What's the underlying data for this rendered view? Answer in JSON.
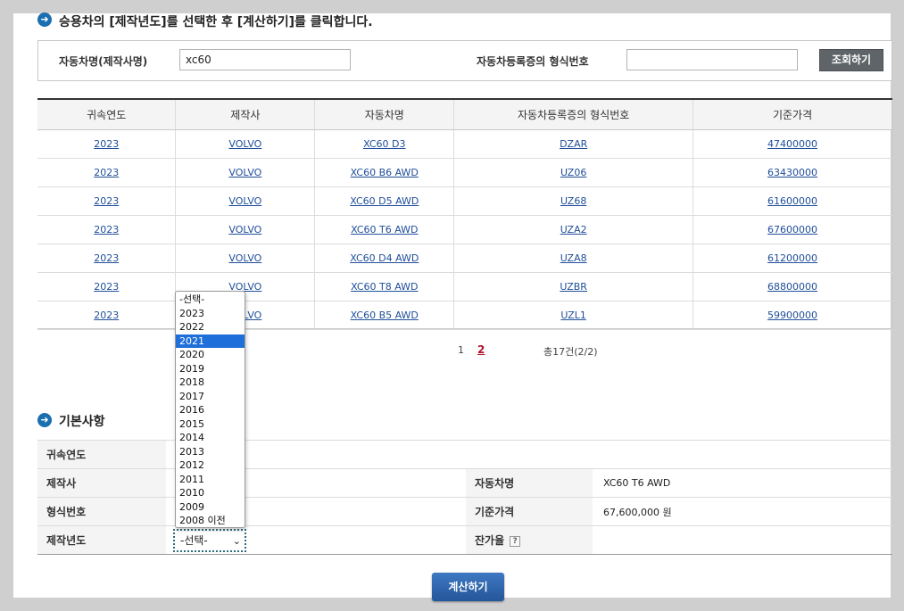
{
  "instruction": {
    "text": "승용차의 [제작년도]를 선택한 후 [계산하기]를 클릭합니다.",
    "bullet_icon": "arrow-right-circle-icon"
  },
  "search": {
    "model_label": "자동차명(제작사명)",
    "model_value": "xc60",
    "type_label": "자동차등록증의 형식번호",
    "type_value": "",
    "query_button": "조회하기"
  },
  "results": {
    "headers": [
      "귀속연도",
      "제작사",
      "자동차명",
      "자동차등록증의 형식번호",
      "기준가격"
    ],
    "rows": [
      [
        "2023",
        "VOLVO",
        "XC60 D3",
        "DZAR",
        "47400000"
      ],
      [
        "2023",
        "VOLVO",
        "XC60 B6 AWD",
        "UZ06",
        "63430000"
      ],
      [
        "2023",
        "VOLVO",
        "XC60 D5 AWD",
        "UZ68",
        "61600000"
      ],
      [
        "2023",
        "VOLVO",
        "XC60 T6 AWD",
        "UZA2",
        "67600000"
      ],
      [
        "2023",
        "VOLVO",
        "XC60 D4 AWD",
        "UZA8",
        "61200000"
      ],
      [
        "2023",
        "VOLVO",
        "XC60 T8 AWD",
        "UZBR",
        "68800000"
      ],
      [
        "2023",
        "VOLVO",
        "XC60 B5 AWD",
        "UZL1",
        "59900000"
      ]
    ]
  },
  "pagination": {
    "page1": "1",
    "page2": "2",
    "total": "총17건(2/2)"
  },
  "basic": {
    "title": "기본사항",
    "rows": {
      "year_label": "귀속연도",
      "year_value": "",
      "maker_label": "제작사",
      "maker_value": "",
      "model_label": "자동차명",
      "model_value": "XC60 T6 AWD",
      "type_label": "형식번호",
      "type_value": "",
      "price_label": "기준가격",
      "price_value": "67,600,000 원",
      "made_year_label": "제작년도",
      "residual_label": "잔가율",
      "residual_help": "?"
    }
  },
  "year_select": {
    "selected": "-선택-",
    "options": [
      "-선택-",
      "2023",
      "2022",
      "2021",
      "2020",
      "2019",
      "2018",
      "2017",
      "2016",
      "2015",
      "2014",
      "2013",
      "2012",
      "2011",
      "2010",
      "2009",
      "2008 이전"
    ],
    "highlighted": "2021"
  },
  "calc_button": "계산하기"
}
